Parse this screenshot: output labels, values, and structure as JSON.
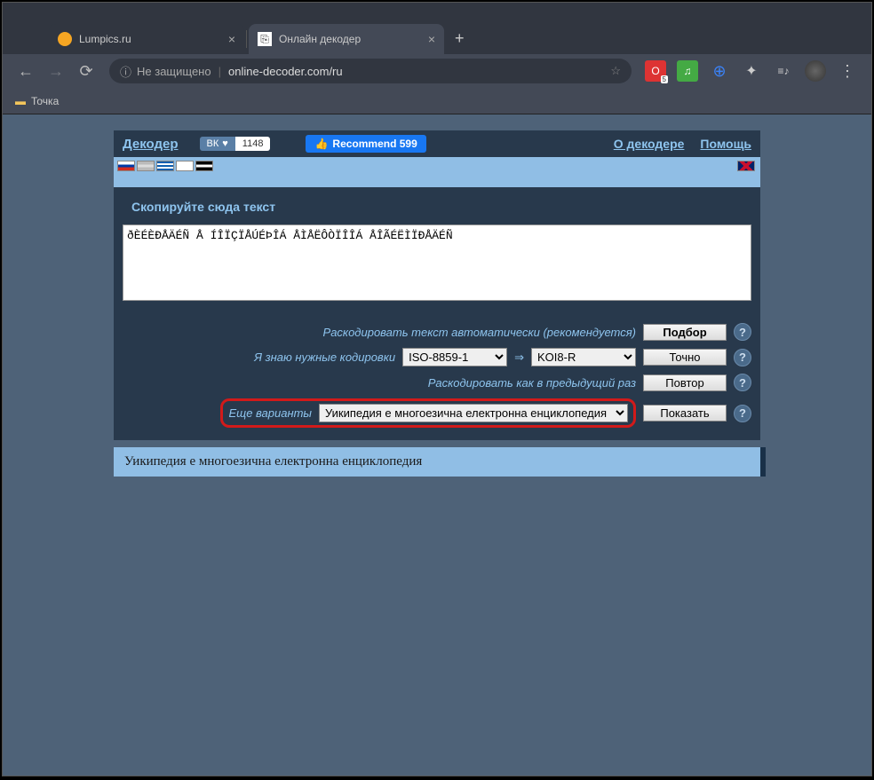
{
  "window": {
    "tabs": [
      {
        "label": "Lumpics.ru",
        "active": false
      },
      {
        "label": "Онлайн декодер",
        "active": true
      }
    ]
  },
  "toolbar": {
    "security": "Не защищено",
    "url": "online-decoder.com/ru"
  },
  "bookmarks": {
    "item1": "Точка"
  },
  "page": {
    "brand": "Декодер",
    "vk_label": "ВК",
    "vk_count": "1148",
    "fb_label": "Recommend 599",
    "nav_about": "О декодере",
    "nav_help": "Помощь",
    "form_title": "Скопируйте сюда текст",
    "textarea_value": "ðÈÉÈÐÅÄÉÑ Å ÍÎÏÇÏÅÚÉÞÎÁ ÅÌÅËÔÒÏÎÎÁ ÅÎÃÉËÌÏÐÅÄÉÑ",
    "row1_label": "Раскодировать текст автоматически (рекомендуется)",
    "btn_podbor": "Подбор",
    "row2_label": "Я знаю нужные кодировки",
    "enc_from": "ISO-8859-1",
    "enc_to": "KOI8-R",
    "btn_tochno": "Точно",
    "row3_label": "Раскодировать как в предыдущий раз",
    "btn_povtor": "Повтор",
    "row4_label": "Еще варианты",
    "variants_selected": "Уикипедия е многоезична електронна енциклопедия",
    "btn_pokazat": "Показать",
    "result_text": "Уикипедия е многоезична електронна енциклопедия"
  }
}
